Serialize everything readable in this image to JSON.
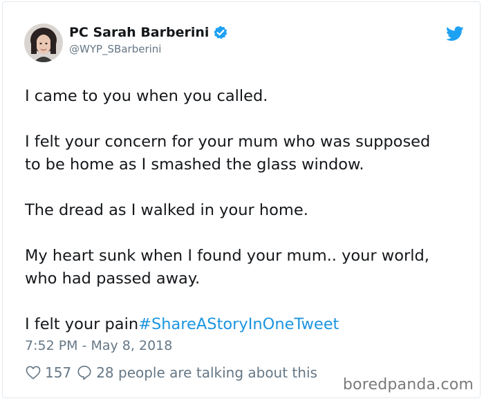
{
  "author": {
    "name": "PC Sarah Barberini",
    "handle": "@WYP_SBarberini",
    "verified": true,
    "avatar_icon": "profile-photo"
  },
  "tweet": {
    "paragraphs": [
      "I came to you when you called.",
      "I felt your concern for your mum who was supposed",
      "to be home as I smashed the glass window.",
      "The dread as I walked in your home.",
      "My heart sunk when I found your mum.. your world,",
      "who had passed away.",
      "I felt your pain",
      "#ShareAStoryInOneTweet"
    ],
    "timestamp": "7:52 PM - May 8, 2018"
  },
  "engagement": {
    "likes": "157",
    "talking": "28 people are talking about this"
  },
  "watermark": "boredpanda.com",
  "colors": {
    "text": "#14171a",
    "muted": "#657786",
    "link": "#1b95e0",
    "twitter_blue": "#1da1f2"
  }
}
